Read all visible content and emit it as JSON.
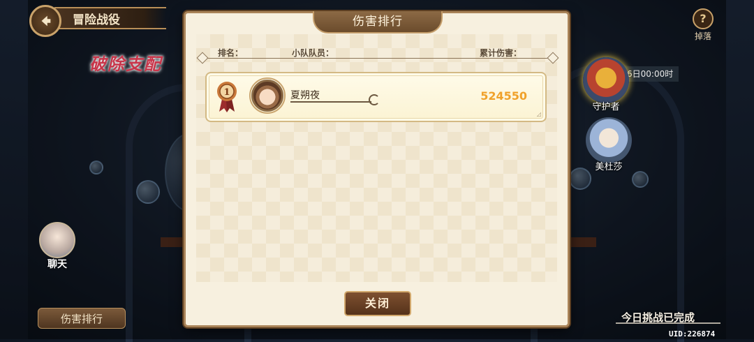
{
  "background": {
    "title": "冒险战役",
    "logo_text": "破除支配",
    "help_label": "掉落",
    "timer_text": "6日00:00时",
    "heroes": [
      {
        "name": "守护者"
      },
      {
        "name": "美杜莎"
      }
    ],
    "chat_label": "聊天",
    "rank_button_label": "伤害排行",
    "challenge_status": "今日挑战已完成",
    "uid": "UID:226874"
  },
  "modal": {
    "title": "伤害排行",
    "columns": {
      "rank": "排名：",
      "members": "小队队员：",
      "damage": "累计伤害："
    },
    "rows": [
      {
        "rank": "1",
        "member_name": "夏朔夜",
        "damage": "524550"
      }
    ],
    "close_label": "关闭"
  },
  "colors": {
    "damage": "#f0a12a",
    "panel": "#f7f0df",
    "frame": "#a98358"
  }
}
